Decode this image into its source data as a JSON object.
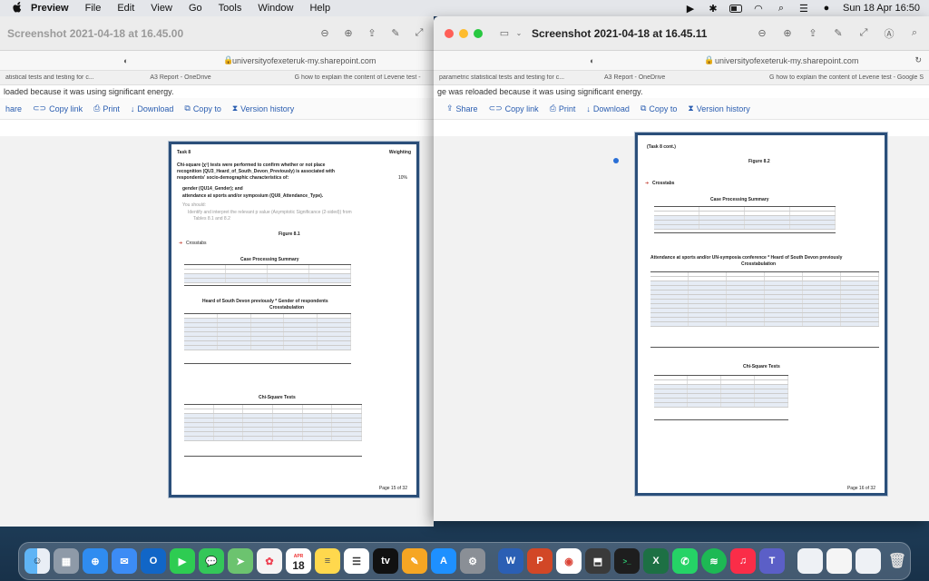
{
  "menubar": {
    "app": "Preview",
    "menus": [
      "File",
      "Edit",
      "View",
      "Go",
      "Tools",
      "Window",
      "Help"
    ],
    "clock": "Sun 18 Apr  16:50"
  },
  "back_window": {
    "title": "Screenshot 2021-04-18 at 16.45.00",
    "url": "universityofexeteruk-my.sharepoint.com",
    "tabs": [
      "atistical tests and testing for c...",
      "A3 Report - OneDrive",
      "G  how to explain the content of Levene test -"
    ],
    "notice": "loaded because it was using significant energy.",
    "actions": [
      "hare",
      "Copy link",
      "Print",
      "Download",
      "Copy to",
      "Version history"
    ],
    "page": {
      "task": "Task 8",
      "weighting": "Weighting",
      "intro": "Chi-square (χ²) tests were performed to confirm whether or not place",
      "intro2": "recognition (QU3_Heard_of_South_Devon_Previously) is associated with",
      "intro3": "respondents' socio-demographic characteristics of:",
      "bullet1": "gender (QU14_Gender); and",
      "bullet2": "attendance at sports and/or symposium (QU8_Attendance_Type).",
      "pct": "10%",
      "youshould": "You should:",
      "identify": "Identify and interpret the relevant p value (Asymptotic Significance (2-sided)) from",
      "tables": "Tables 8.1 and 8.2",
      "figure": "Figure 8.1",
      "crosstabs": "Crosstabs",
      "cps": "Case Processing Summary",
      "ct_title": "Heard of South Devon previously * Gender of respondents",
      "ct_sub": "Crosstabulation",
      "chi": "Chi-Square Tests",
      "pagenum": "Page 15 of 32"
    }
  },
  "front_window": {
    "title": "Screenshot 2021-04-18 at 16.45.11",
    "url": "universityofexeteruk-my.sharepoint.com",
    "tabs": [
      "parametric statistical tests and testing for c...",
      "A3 Report - OneDrive",
      "G  how to explain the content of Levene test - Google S"
    ],
    "notice": "ge was reloaded because it was using significant energy.",
    "actions": [
      "Share",
      "Copy link",
      "Print",
      "Download",
      "Copy to",
      "Version history"
    ],
    "page": {
      "cont": "(Task 8 cont.)",
      "figure": "Figure 8.2",
      "crosstabs": "Crosstabs",
      "cps": "Case Processing Summary",
      "ct_title": "Attendance at sports and/or UN-symposia conference * Heard of South Devon previously",
      "ct_sub": "Crosstabulation",
      "chi": "Chi-Square Tests",
      "pagenum": "Page 16 of 32"
    }
  },
  "dock": {
    "calendar_month": "APR",
    "calendar_day": "18",
    "apps": [
      "finder-icon",
      "launchpad-icon",
      "safari-icon",
      "mail-icon",
      "outlook-icon",
      "facetime-icon",
      "messages-icon",
      "maps-icon",
      "photos-icon",
      "calendar-icon",
      "notes-icon",
      "reminders-icon",
      "appletv-icon",
      "pages-icon",
      "appstore-icon",
      "settings-icon",
      "word-icon",
      "powerpoint-icon",
      "chrome-icon",
      "preview-icon",
      "terminal-icon",
      "excel-icon",
      "whatsapp-icon",
      "spotify-icon",
      "music-icon",
      "teams-icon"
    ]
  }
}
